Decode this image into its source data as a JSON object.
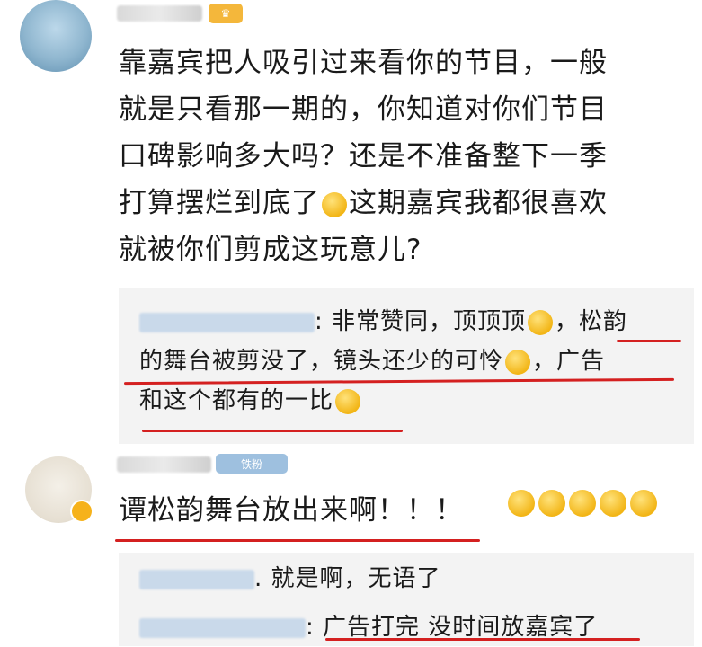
{
  "comment1": {
    "text_lines": [
      "靠嘉宾把人吸引过来看你的节目，一般",
      "就是只看那一期的，你知道对你们节目",
      "口碑影响多大吗？还是不准备整下一季",
      "打算摆烂到底了",
      "这期嘉宾我都很喜欢",
      "就被你们剪成这玩意儿?"
    ]
  },
  "reply1": {
    "line1": ": 非常赞同，顶顶顶",
    "line1b": "，松韵",
    "line2": "的舞台被剪没了，镜头还少的可怜",
    "line2b": "，广告",
    "line3": "和这个都有的一比"
  },
  "comment2": {
    "badge": "铁粉",
    "text": "谭松韵舞台放出来啊！！！"
  },
  "reply2": {
    "text": ". 就是啊，无语了"
  },
  "reply3": {
    "text": ": 广告打完 没时间放嘉宾了"
  },
  "colors": {
    "highlight": "#d42020",
    "reply_bg": "#f3f3f3"
  }
}
